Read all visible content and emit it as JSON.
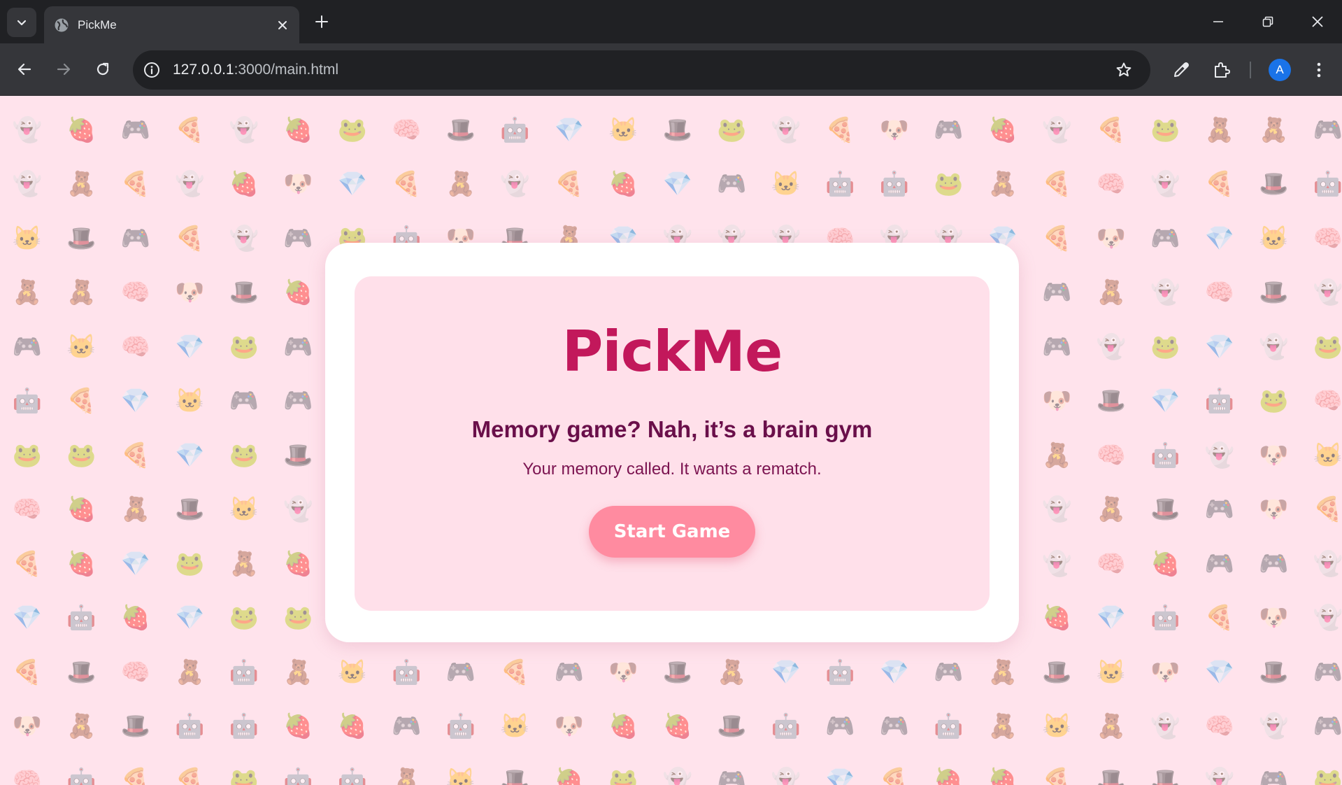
{
  "browser": {
    "tab_title": "PickMe",
    "url_host": "127.0.0.1",
    "url_rest": ":3000/main.html",
    "avatar_letter": "A"
  },
  "page": {
    "logo": "PickMe",
    "headline": "Memory game? Nah, it’s a brain gym",
    "subline": "Your memory called. It wants a rematch.",
    "start_button": "Start Game",
    "accent_color": "#c2185b",
    "button_color": "#ff8ba0",
    "background_color": "#ffe3ec",
    "background_icons": [
      "frog",
      "gamepad",
      "pizza",
      "diamond",
      "robot",
      "ghost",
      "strawberry",
      "top-hat",
      "dog",
      "cat",
      "brain",
      "teddy-bear"
    ]
  }
}
